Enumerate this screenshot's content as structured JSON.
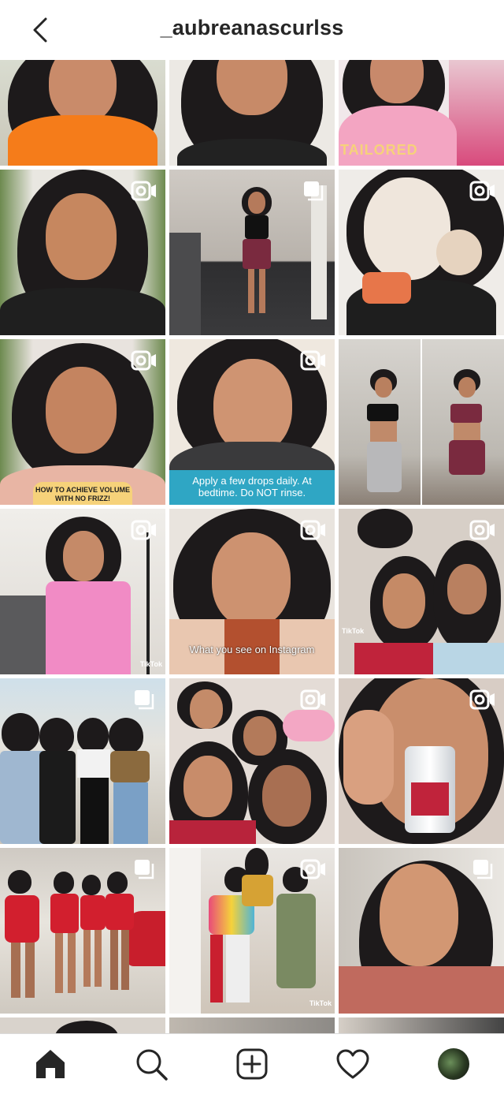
{
  "header": {
    "title": "_aubreanascurlss"
  },
  "tiles": [
    {
      "badge": "none",
      "caption": ""
    },
    {
      "badge": "none",
      "caption": ""
    },
    {
      "badge": "none",
      "caption": "TAILORED"
    },
    {
      "badge": "video",
      "caption": ""
    },
    {
      "badge": "carousel",
      "caption": ""
    },
    {
      "badge": "video",
      "caption": ""
    },
    {
      "badge": "video",
      "caption": "HOW TO ACHIEVE VOLUME WITH NO FRIZZ!"
    },
    {
      "badge": "video",
      "caption": "Apply a few drops daily. At bedtime. Do NOT rinse."
    },
    {
      "badge": "none",
      "caption": ""
    },
    {
      "badge": "video",
      "caption": "TikTok"
    },
    {
      "badge": "video",
      "caption": "What you see on Instagram"
    },
    {
      "badge": "video",
      "caption": "TikTok"
    },
    {
      "badge": "carousel",
      "caption": ""
    },
    {
      "badge": "video",
      "caption": ""
    },
    {
      "badge": "video",
      "caption": ""
    },
    {
      "badge": "carousel",
      "caption": ""
    },
    {
      "badge": "video",
      "caption": "TikTok"
    },
    {
      "badge": "carousel",
      "caption": ""
    }
  ],
  "bottom_nav": [
    {
      "name": "home",
      "icon": "home-icon"
    },
    {
      "name": "search",
      "icon": "search-icon"
    },
    {
      "name": "create",
      "icon": "add-post-icon"
    },
    {
      "name": "activity",
      "icon": "heart-icon"
    },
    {
      "name": "profile",
      "icon": "avatar"
    }
  ]
}
